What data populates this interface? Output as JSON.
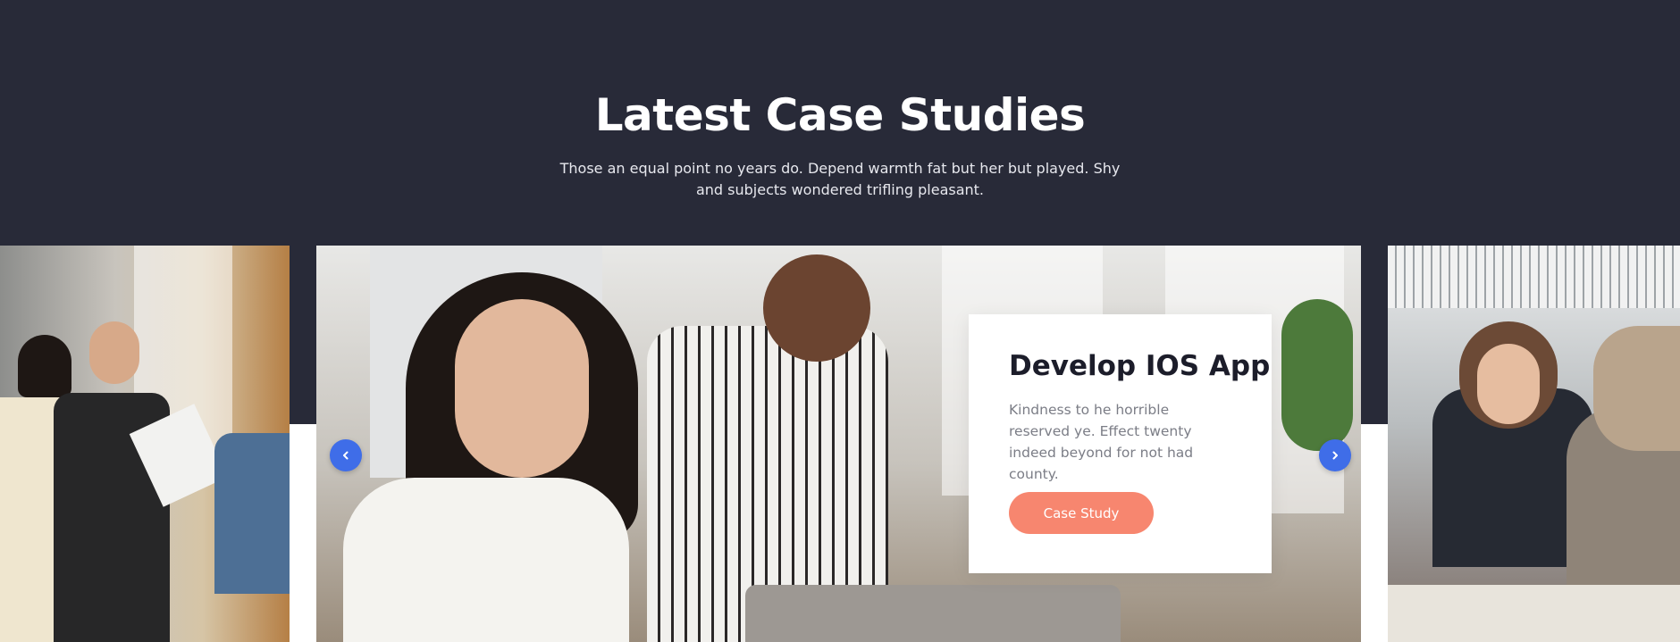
{
  "section": {
    "title": "Latest Case Studies",
    "subtitle": "Those an equal point no years do. Depend warmth fat but her but played. Shy and subjects wondered trifling pleasant."
  },
  "active_slide": {
    "title": "Develop IOS App",
    "description": "Kindness to he horrible reserved ye. Effect twenty indeed beyond for not had county.",
    "button_label": "Case Study"
  },
  "carousel": {
    "prev_icon": "chevron-left-icon",
    "next_icon": "chevron-right-icon"
  },
  "colors": {
    "hero_bg": "#282a38",
    "accent_button": "#f7866f",
    "nav_arrow": "#3f6de8"
  }
}
